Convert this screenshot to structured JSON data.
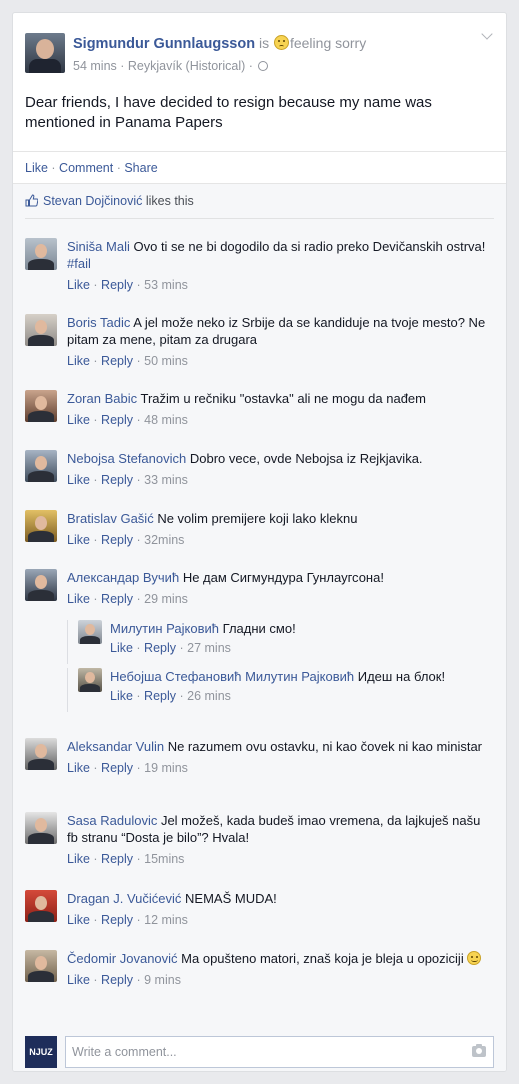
{
  "post": {
    "author": "Sigmundur Gunnlaugsson",
    "status_prefix": "is",
    "feeling": "feeling sorry",
    "time": "54 mins",
    "location": "Reykjavík (Historical)",
    "text": "Dear friends, I have decided to resign because my name was mentioned in Panama Papers"
  },
  "actions": {
    "like": "Like",
    "comment": "Comment",
    "share": "Share"
  },
  "likes": {
    "name": "Stevan Dojčinović",
    "suffix": "likes this"
  },
  "comment_actions": {
    "like": "Like",
    "reply": "Reply"
  },
  "comments": [
    {
      "author": "Siniša Mali",
      "text": "Ovo ti se ne bi dogodilo da si radio preko Devičanskih ostrva!",
      "hashtag": "#fail",
      "time": "53 mins"
    },
    {
      "author": "Boris Tadic",
      "text": "A jel može neko iz Srbije da se kandiduje na tvoje mesto? Ne pitam za mene, pitam za drugara",
      "time": "50 mins"
    },
    {
      "author": "Zoran Babic",
      "text": "Tražim u rečniku \"ostavka\" ali ne mogu da nađem",
      "time": "48 mins"
    },
    {
      "author": "Nebojsa Stefanovich",
      "text": "Dobro vece, ovde Nebojsa iz Rejkjavika.",
      "time": "33 mins"
    },
    {
      "author": "Bratislav Gašić",
      "text": "Ne volim premijere koji lako kleknu",
      "time": "32mins"
    },
    {
      "author": "Александар Вучић",
      "text": "Не дам Сигмундура Гунлаугсона!",
      "time": "29 mins"
    },
    {
      "author": "Милутин Рајковић",
      "text": "Гладни смо!",
      "time": "27 mins"
    },
    {
      "author": "Небојша Стефановић",
      "mention": "Милутин Рајковић",
      "text": "Идеш на блок!",
      "time": "26 mins"
    },
    {
      "author": "Aleksandar Vulin",
      "text": "Ne razumem ovu ostavku, ni kao čovek ni kao ministar",
      "time": "19 mins"
    },
    {
      "author": "Sasa Radulovic",
      "text": "Jel možeš, kada budeš imao vremena, da lajkuješ našu fb stranu “Dosta je bilo”? Hvala!",
      "time": "15mins"
    },
    {
      "author": "Dragan J. Vučićević",
      "text": "NEMAŠ MUDA!",
      "time": "12 mins"
    },
    {
      "author": "Čedomir Jovanović",
      "text": "Ma opušteno matori, znaš koja je bleja u opoziciji",
      "time": "9 mins"
    }
  ],
  "composer": {
    "brand": "NJUZ",
    "placeholder": "Write a comment..."
  },
  "icons": {
    "chevron": "chevron-down-icon",
    "globe": "globe-icon",
    "thumb": "thumbs-up-icon",
    "camera": "camera-icon",
    "smiley": "smiley-icon"
  },
  "colors": {
    "link": "#3b5998",
    "meta": "#90949c",
    "background": "#e9eaed",
    "comments_bg": "#f6f7f9"
  }
}
